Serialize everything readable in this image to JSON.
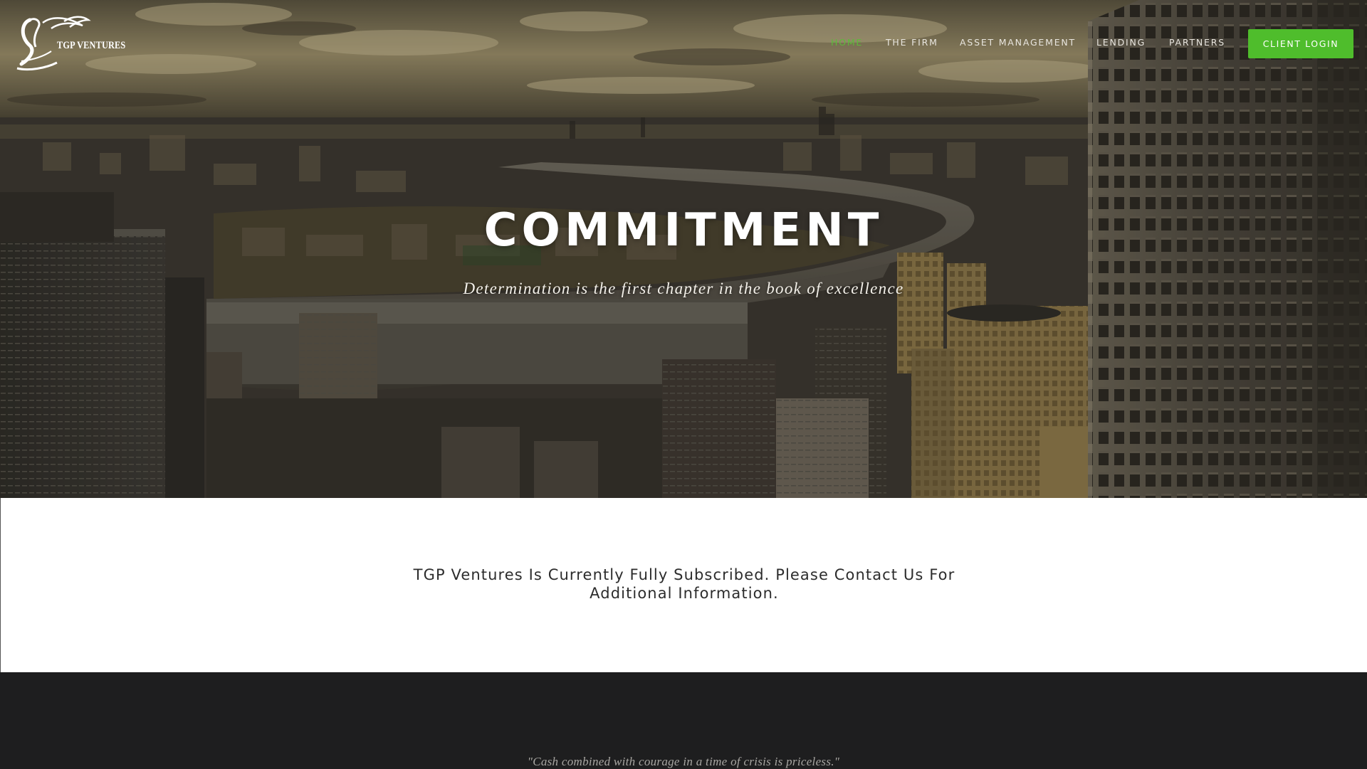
{
  "brand": {
    "name": "TGP VENTURES"
  },
  "nav": {
    "items": [
      {
        "label": "HOME",
        "active": true
      },
      {
        "label": "THE FIRM",
        "active": false
      },
      {
        "label": "ASSET MANAGEMENT",
        "active": false
      },
      {
        "label": "LENDING",
        "active": false
      },
      {
        "label": "PARTNERS",
        "active": false
      }
    ],
    "login_label": "CLIENT LOGIN"
  },
  "hero": {
    "title": "COMMITMENT",
    "subtitle": "Determination is the first chapter in the book of excellence"
  },
  "notice": {
    "text": "TGP Ventures Is Currently Fully Subscribed. Please Contact Us For Additional Information."
  },
  "quote": {
    "text": "\"Cash combined with courage in a time of crisis is priceless.\""
  },
  "colors": {
    "accent": "#4fbd2c",
    "nav_active": "#5dba3a",
    "dark_band": "#1e1e1f"
  }
}
